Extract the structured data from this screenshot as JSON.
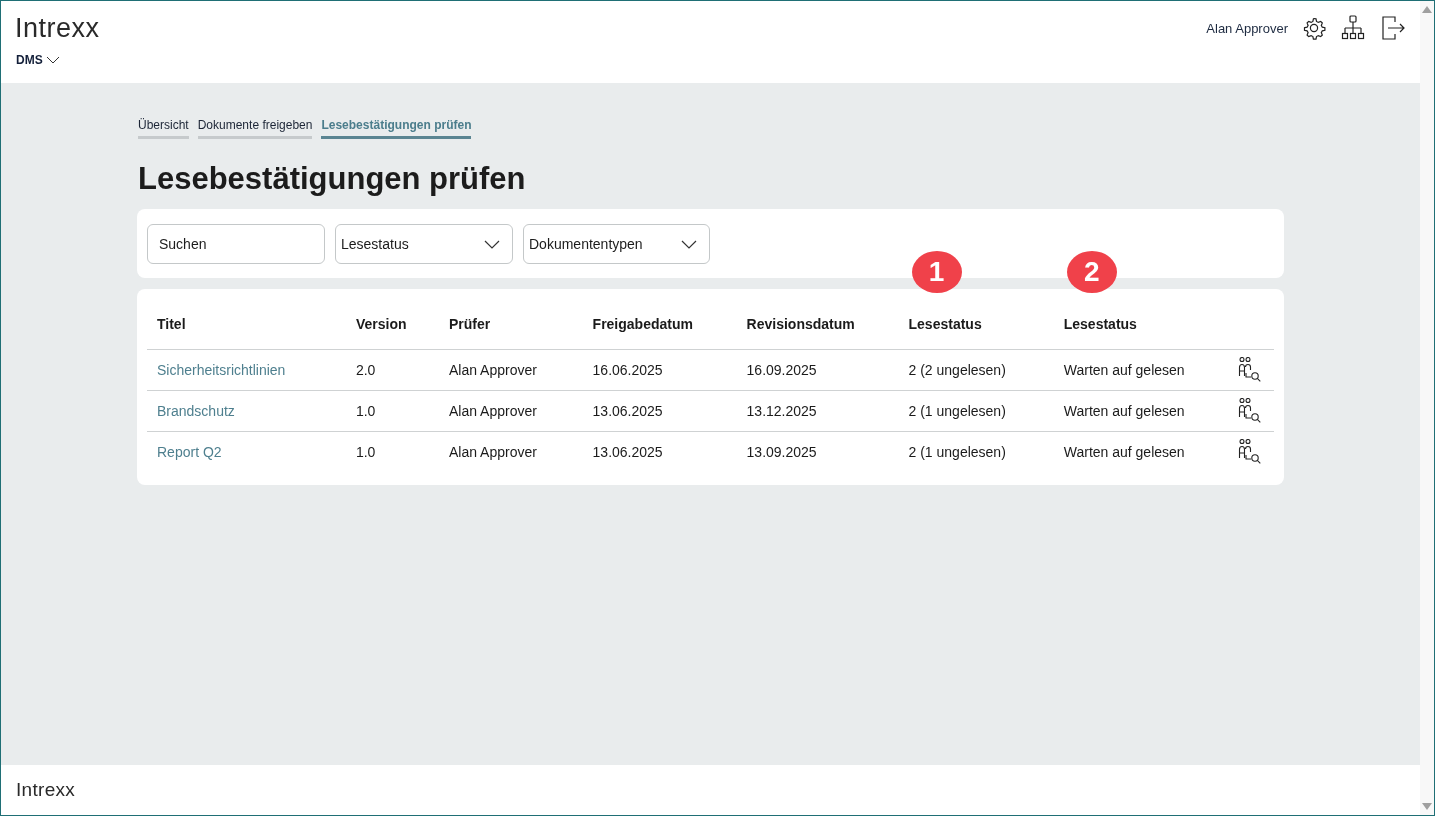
{
  "header": {
    "logo": "Intrexx",
    "app_menu": {
      "label": "DMS"
    },
    "user": "Alan Approver"
  },
  "tabs": [
    {
      "label": "Übersicht",
      "selected": false
    },
    {
      "label": "Dokumente freigeben",
      "selected": false
    },
    {
      "label": "Lesebestätigungen prüfen",
      "selected": true
    }
  ],
  "page_title": "Lesebestätigungen prüfen",
  "filters": {
    "search": {
      "placeholder": "Suchen"
    },
    "dropdowns": [
      {
        "label": "Lesestatus"
      },
      {
        "label": "Dokumententypen"
      }
    ]
  },
  "table": {
    "columns": [
      {
        "label": "Titel"
      },
      {
        "label": "Version"
      },
      {
        "label": "Prüfer"
      },
      {
        "label": "Freigabedatum"
      },
      {
        "label": "Revisionsdatum"
      },
      {
        "label": "Lesestatus",
        "annotation": "1"
      },
      {
        "label": "Lesestatus",
        "annotation": "2"
      }
    ],
    "rows": [
      {
        "cells": [
          "Sicherheitsrichtlinien",
          "2.0",
          "Alan Approver",
          "16.06.2025",
          "16.09.2025",
          "2 (2 ungelesen)",
          "Warten auf gelesen"
        ]
      },
      {
        "cells": [
          "Brandschutz",
          "1.0",
          "Alan Approver",
          "13.06.2025",
          "13.12.2025",
          "2 (1 ungelesen)",
          "Warten auf gelesen"
        ]
      },
      {
        "cells": [
          "Report Q2",
          "1.0",
          "Alan Approver",
          "13.06.2025",
          "13.09.2025",
          "2 (1 ungelesen)",
          "Warten auf gelesen"
        ]
      }
    ]
  },
  "footer": {
    "logo": "Intrexx"
  }
}
